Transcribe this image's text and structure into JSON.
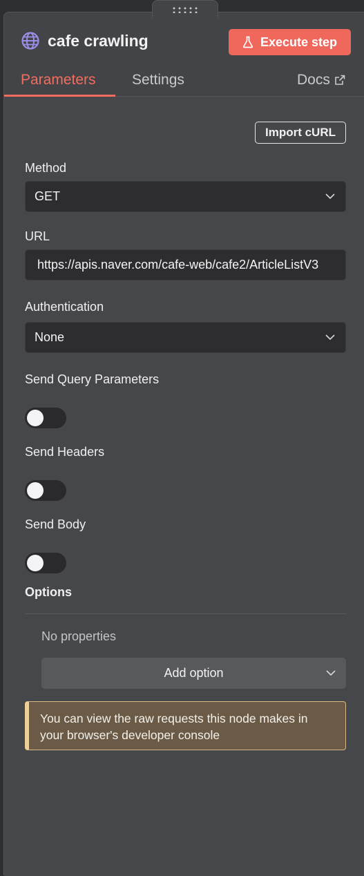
{
  "node": {
    "title": "cafe crawling",
    "icon": "globe-icon"
  },
  "toolbar": {
    "execute_label": "Execute step"
  },
  "tabs": [
    {
      "label": "Parameters",
      "active": true
    },
    {
      "label": "Settings",
      "active": false
    },
    {
      "label": "Docs",
      "active": false,
      "icon": "external-link-icon"
    }
  ],
  "import_curl_label": "Import cURL",
  "method": {
    "label": "Method",
    "value": "GET"
  },
  "url": {
    "label": "URL",
    "value": "https://apis.naver.com/cafe-web/cafe2/ArticleListV3"
  },
  "authentication": {
    "label": "Authentication",
    "value": "None"
  },
  "send_query": {
    "label": "Send Query Parameters",
    "enabled": false
  },
  "send_headers": {
    "label": "Send Headers",
    "enabled": false
  },
  "send_body": {
    "label": "Send Body",
    "enabled": false
  },
  "options": {
    "label": "Options",
    "empty_text": "No properties",
    "add_label": "Add option"
  },
  "notice": {
    "text": "You can view the raw requests this node makes in your browser's developer console"
  },
  "colors": {
    "accent": "#f0675c",
    "panel_bg": "#46474a",
    "field_bg": "#2d2d30",
    "notice_border": "#f0cf94"
  }
}
